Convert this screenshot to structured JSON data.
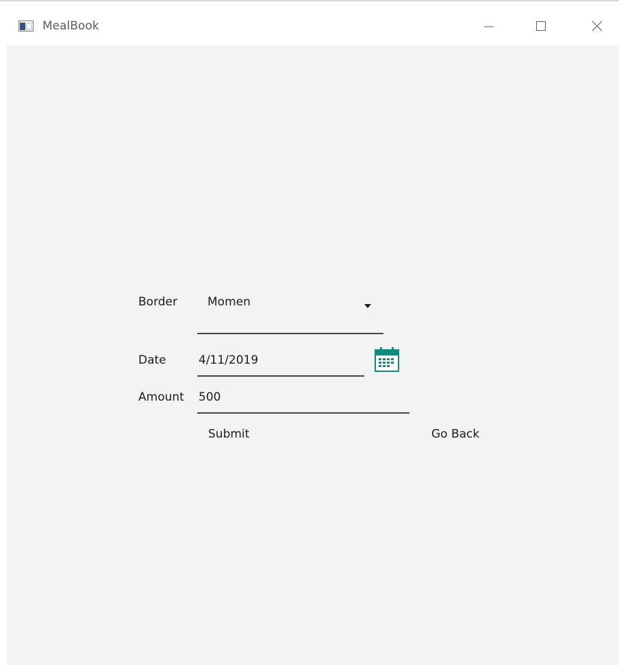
{
  "window": {
    "title": "MealBook",
    "controls": {
      "minimize_icon": "minimize-icon",
      "maximize_icon": "maximize-icon",
      "close_icon": "close-icon"
    }
  },
  "form": {
    "border": {
      "label": "Border",
      "selected": "Momen"
    },
    "date": {
      "label": "Date",
      "value": "4/11/2019",
      "icon": "calendar-icon"
    },
    "amount": {
      "label": "Amount",
      "value": "500"
    },
    "buttons": {
      "submit_label": "Submit",
      "go_back_label": "Go Back"
    }
  },
  "colors": {
    "content_background": "#f3f3f3",
    "titlebar_background": "#ffffff",
    "accent_calendar": "#128b7a",
    "text": "#1c1c1c"
  }
}
